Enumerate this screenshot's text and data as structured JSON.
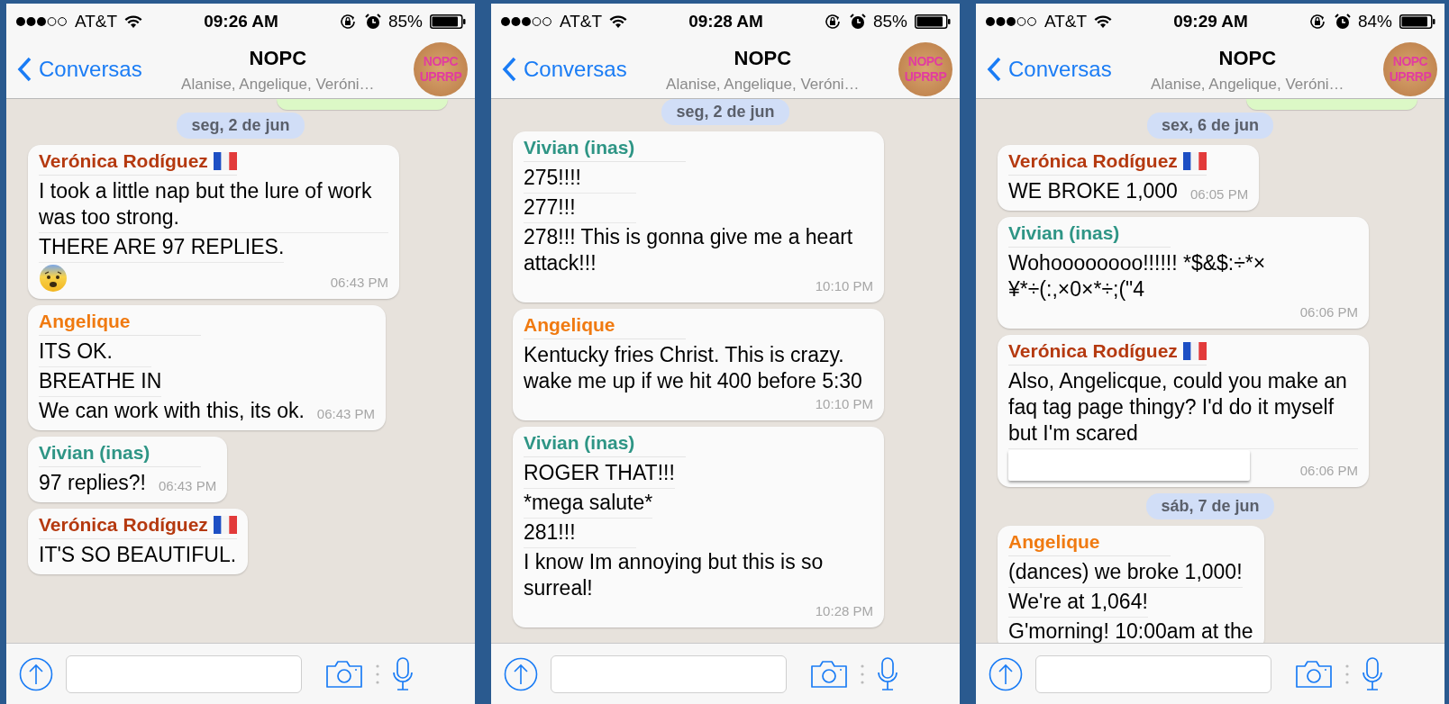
{
  "phones": [
    {
      "status": {
        "carrier": "AT&T",
        "time": "09:26 AM",
        "battery": "85%"
      },
      "nav": {
        "back": "Conversas",
        "title": "NOPC",
        "subtitle": "Alanise, Angelique, Veróni…",
        "avatar": [
          "NOPC",
          "UPRRP"
        ]
      },
      "chat": [
        {
          "kind": "outgoing_partial"
        },
        {
          "kind": "date",
          "text": "seg, 2 de jun"
        },
        {
          "kind": "message",
          "sender": "Verónica Rodíguez",
          "color": "#b5390f",
          "flag": true,
          "segments": [
            {
              "kind": "text",
              "text": "I took a little nap but the lure of work was too strong."
            },
            {
              "kind": "text",
              "text": "THERE ARE 97 REPLIES."
            },
            {
              "kind": "emoji"
            }
          ],
          "time": "06:43 PM"
        },
        {
          "kind": "message",
          "sender": "Angelique",
          "color": "#f07a10",
          "flag": false,
          "segments": [
            {
              "kind": "text",
              "text": "ITS OK."
            },
            {
              "kind": "text",
              "text": "BREATHE IN"
            },
            {
              "kind": "text",
              "text": "We can work with this, its ok."
            }
          ],
          "time": "06:43 PM"
        },
        {
          "kind": "message",
          "sender": "Vivian (inas)",
          "color": "#2e9585",
          "flag": false,
          "segments": [
            {
              "kind": "text",
              "text": "97 replies?!"
            }
          ],
          "time": "06:43 PM"
        },
        {
          "kind": "message",
          "sender": "Verónica Rodíguez",
          "color": "#b5390f",
          "flag": true,
          "segments": [
            {
              "kind": "text",
              "text": "IT'S SO BEAUTIFUL."
            }
          ]
        }
      ]
    },
    {
      "status": {
        "carrier": "AT&T",
        "time": "09:28 AM",
        "battery": "85%"
      },
      "nav": {
        "back": "Conversas",
        "title": "NOPC",
        "subtitle": "Alanise, Angelique, Veróni…",
        "avatar": [
          "NOPC",
          "UPRRP"
        ]
      },
      "chat": [
        {
          "kind": "date",
          "text": "seg, 2 de jun"
        },
        {
          "kind": "message",
          "sender": "Vivian (inas)",
          "color": "#2e9585",
          "flag": false,
          "segments": [
            {
              "kind": "text",
              "text": "275!!!!"
            },
            {
              "kind": "text",
              "text": "277!!!"
            },
            {
              "kind": "text",
              "text": "278!!! This is gonna give me a heart attack!!!"
            }
          ],
          "time": "10:10 PM"
        },
        {
          "kind": "message",
          "sender": "Angelique",
          "color": "#f07a10",
          "flag": false,
          "segments": [
            {
              "kind": "text",
              "text": "Kentucky fries Christ. This is crazy. wake me up if we hit 400 before 5:30"
            }
          ],
          "time": "10:10 PM"
        },
        {
          "kind": "message",
          "sender": "Vivian (inas)",
          "color": "#2e9585",
          "flag": false,
          "segments": [
            {
              "kind": "text",
              "text": "ROGER THAT!!!"
            },
            {
              "kind": "text",
              "text": "*mega salute*"
            },
            {
              "kind": "text",
              "text": "281!!!"
            },
            {
              "kind": "text",
              "text": "I know Im annoying but this is so surreal!"
            }
          ],
          "time": "10:28 PM"
        }
      ]
    },
    {
      "status": {
        "carrier": "AT&T",
        "time": "09:29 AM",
        "battery": "84%"
      },
      "nav": {
        "back": "Conversas",
        "title": "NOPC",
        "subtitle": "Alanise, Angelique, Veróni…",
        "avatar": [
          "NOPC",
          "UPRRP"
        ]
      },
      "chat": [
        {
          "kind": "outgoing_partial"
        },
        {
          "kind": "date",
          "text": "sex, 6 de jun"
        },
        {
          "kind": "message",
          "sender": "Verónica Rodíguez",
          "color": "#b5390f",
          "flag": true,
          "segments": [
            {
              "kind": "text",
              "text": "WE BROKE 1,000"
            }
          ],
          "time": "06:05 PM"
        },
        {
          "kind": "message",
          "sender": "Vivian (inas)",
          "color": "#2e9585",
          "flag": false,
          "segments": [
            {
              "kind": "text",
              "text": "Wohoooooooo!!!!!! *$&$:÷*× ¥*÷(:,×0×*÷;(\"4"
            }
          ],
          "time": "06:06 PM"
        },
        {
          "kind": "message",
          "sender": "Verónica Rodíguez",
          "color": "#b5390f",
          "flag": true,
          "segments": [
            {
              "kind": "text",
              "text": "Also, Angelicque, could you make an faq tag page thingy? I'd do it myself but I'm scared"
            },
            {
              "kind": "blank"
            }
          ],
          "time": "06:06 PM"
        },
        {
          "kind": "date",
          "text": "sáb, 7 de jun"
        },
        {
          "kind": "message",
          "sender": "Angelique",
          "color": "#f07a10",
          "flag": false,
          "segments": [
            {
              "kind": "text",
              "text": "(dances) we broke 1,000!"
            },
            {
              "kind": "text",
              "text": "We're at 1,064!"
            },
            {
              "kind": "text",
              "text": "G'morning! 10:00am at the"
            }
          ]
        }
      ]
    }
  ]
}
